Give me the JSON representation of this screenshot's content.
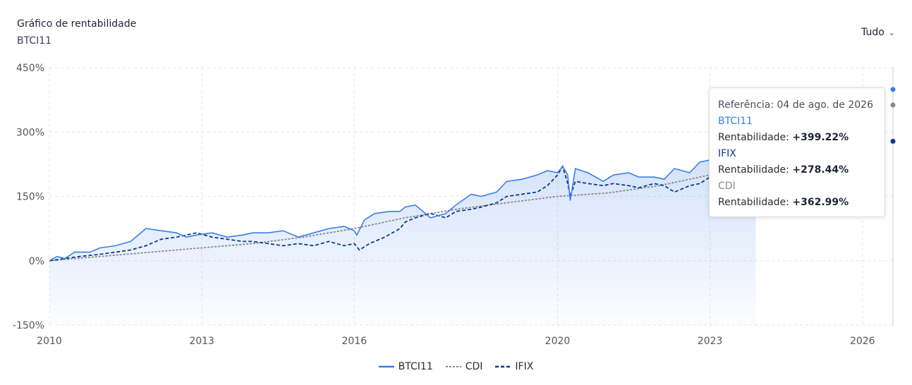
{
  "header": {
    "title": "Gráfico de rentabilidade",
    "subtitle": "BTCI11",
    "period_label": "Tudo"
  },
  "tooltip": {
    "reference": "Referência: 04 de ago. de 2026",
    "rows": [
      {
        "series": "BTCI11",
        "label": "Rentabilidade:",
        "value": "+399.22%"
      },
      {
        "series": "IFIX",
        "label": "Rentabilidade:",
        "value": "+278.44%"
      },
      {
        "series": "CDI",
        "label": "Rentabilidade:",
        "value": "+362.99%"
      }
    ]
  },
  "legend": [
    "BTCI11",
    "CDI",
    "IFIX"
  ],
  "colors": {
    "btci": "#3b7ee8",
    "cdi": "#888888",
    "ifix": "#0b3a8a",
    "grid": "#e6e6e6"
  },
  "chart_data": {
    "type": "line",
    "yticks": [
      "450%",
      "300%",
      "150%",
      "0%",
      "-150%"
    ],
    "xticks": [
      "2010",
      "2013",
      "2016",
      "2020",
      "2023",
      "2026"
    ],
    "ylim": [
      -150,
      450
    ],
    "xlim": [
      2010,
      2026.6
    ],
    "grid": true,
    "legend_position": "bottom",
    "series": [
      {
        "name": "BTCI11",
        "x": [
          2010.0,
          2010.15,
          2010.3,
          2010.5,
          2010.8,
          2011.0,
          2011.3,
          2011.6,
          2011.9,
          2012.2,
          2012.5,
          2012.7,
          2012.9,
          2013.2,
          2013.5,
          2013.8,
          2014.0,
          2014.3,
          2014.6,
          2014.9,
          2015.2,
          2015.5,
          2015.8,
          2016.0,
          2016.05,
          2016.2,
          2016.4,
          2016.7,
          2016.9,
          2017.0,
          2017.2,
          2017.5,
          2017.8,
          2018.0,
          2018.3,
          2018.5,
          2018.8,
          2019.0,
          2019.3,
          2019.6,
          2019.8,
          2020.0,
          2020.1,
          2020.2,
          2020.25,
          2020.35,
          2020.6,
          2020.9,
          2021.1,
          2021.4,
          2021.6,
          2021.9,
          2022.1,
          2022.3,
          2022.6,
          2022.8,
          2023.0,
          2023.05,
          2023.3,
          2023.6,
          2023.9
        ],
        "y": [
          0,
          10,
          5,
          20,
          20,
          30,
          35,
          45,
          75,
          70,
          65,
          55,
          60,
          65,
          55,
          60,
          65,
          65,
          70,
          55,
          65,
          75,
          80,
          70,
          60,
          95,
          110,
          115,
          115,
          125,
          130,
          100,
          110,
          130,
          155,
          150,
          160,
          185,
          190,
          200,
          210,
          205,
          220,
          200,
          140,
          215,
          205,
          185,
          200,
          205,
          195,
          195,
          190,
          215,
          205,
          230,
          235,
          195,
          215,
          225,
          235
        ]
      },
      {
        "name": "IFIX",
        "x": [
          2010.0,
          2010.3,
          2010.6,
          2011.0,
          2011.3,
          2011.6,
          2011.9,
          2012.2,
          2012.5,
          2012.7,
          2012.9,
          2013.2,
          2013.5,
          2013.8,
          2014.0,
          2014.3,
          2014.6,
          2014.9,
          2015.2,
          2015.5,
          2015.8,
          2016.0,
          2016.1,
          2016.3,
          2016.6,
          2016.9,
          2017.0,
          2017.2,
          2017.5,
          2017.8,
          2018.0,
          2018.3,
          2018.5,
          2018.8,
          2019.0,
          2019.3,
          2019.6,
          2019.8,
          2020.0,
          2020.1,
          2020.2,
          2020.25,
          2020.35,
          2020.6,
          2020.9,
          2021.1,
          2021.4,
          2021.6,
          2021.9,
          2022.1,
          2022.3,
          2022.6,
          2022.8,
          2023.0,
          2023.05,
          2023.3,
          2023.6,
          2023.9
        ],
        "y": [
          0,
          5,
          10,
          15,
          20,
          25,
          35,
          50,
          55,
          60,
          65,
          55,
          50,
          45,
          45,
          40,
          35,
          40,
          35,
          45,
          35,
          40,
          25,
          40,
          55,
          75,
          90,
          100,
          110,
          100,
          115,
          120,
          125,
          135,
          150,
          155,
          160,
          175,
          200,
          220,
          180,
          150,
          185,
          180,
          175,
          180,
          175,
          170,
          180,
          175,
          160,
          175,
          180,
          195,
          190,
          180,
          185,
          190
        ]
      },
      {
        "name": "CDI",
        "x": [
          2010.0,
          2011.0,
          2012.0,
          2013.0,
          2014.0,
          2015.0,
          2016.0,
          2017.0,
          2018.0,
          2019.0,
          2020.0,
          2021.0,
          2022.0,
          2023.0,
          2023.9
        ],
        "y": [
          0,
          10,
          20,
          30,
          40,
          55,
          75,
          100,
          120,
          135,
          150,
          158,
          175,
          200,
          225
        ]
      }
    ],
    "endpoints": {
      "BTCI11": 399.22,
      "IFIX": 278.44,
      "CDI": 362.99
    }
  }
}
